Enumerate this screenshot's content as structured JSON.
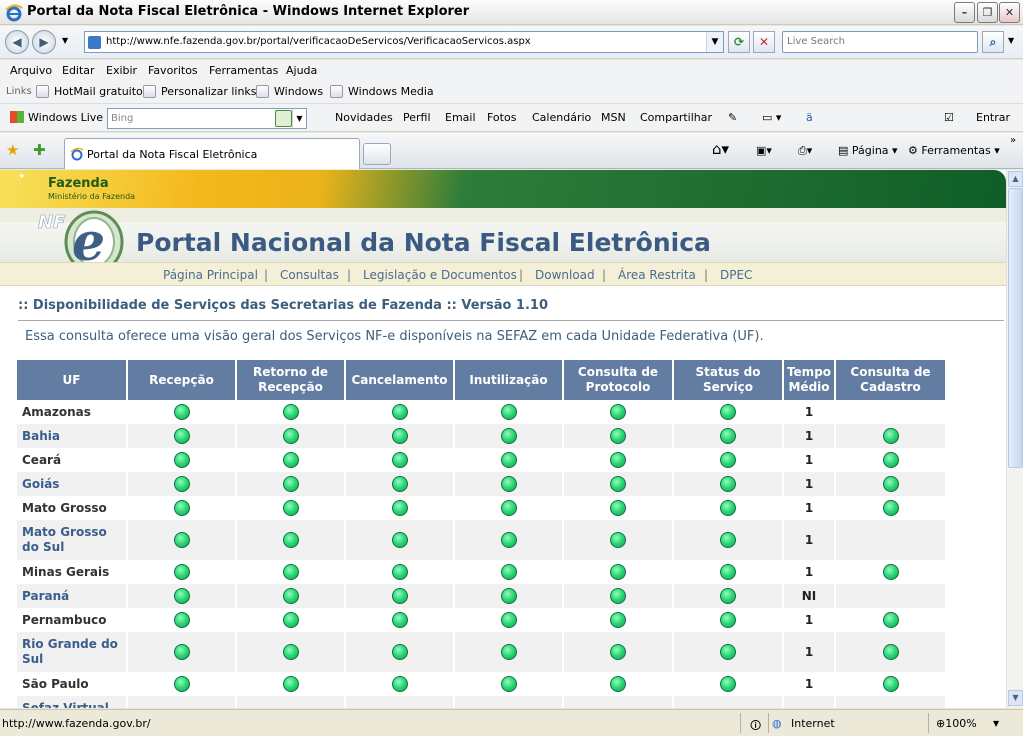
{
  "window": {
    "title": "Portal da Nota Fiscal Eletrônica - Windows Internet Explorer",
    "address": "http://www.nfe.fazenda.gov.br/portal/verificacaoDeServicos/VerificacaoServicos.aspx",
    "search_placeholder": "Live Search"
  },
  "menu": [
    "Arquivo",
    "Editar",
    "Exibir",
    "Favoritos",
    "Ferramentas",
    "Ajuda"
  ],
  "links_bar": {
    "label": "Links",
    "items": [
      "HotMail gratuito",
      "Personalizar links",
      "Windows",
      "Windows Media"
    ]
  },
  "live_bar": {
    "brand": "Windows Live",
    "search_placeholder": "Bing",
    "items": [
      "Novidades",
      "Perfil",
      "Email",
      "Fotos",
      "Calendário",
      "MSN",
      "Compartilhar"
    ],
    "signin": "Entrar"
  },
  "tabs": {
    "active": "Portal da Nota Fiscal Eletrônica",
    "page_menu": "Página",
    "tools_menu": "Ferramentas"
  },
  "page": {
    "banner_title": "Fazenda",
    "banner_subtitle": "Ministério da Fazenda",
    "portal_title": "Portal Nacional da Nota Fiscal Eletrônica",
    "nav": [
      "Página Principal",
      "Consultas",
      "Legislação e Documentos",
      "Download",
      "Área Restrita",
      "DPEC"
    ],
    "section_title": ":: Disponibilidade de Serviços das Secretarias de Fazenda :: Versão 1.10",
    "intro": "Essa consulta oferece uma visão geral dos Serviços NF-e disponíveis na SEFAZ em cada Unidade Federativa (UF).",
    "columns": [
      "UF",
      "Recepção",
      "Retorno de Recepção",
      "Cancelamento",
      "Inutilização",
      "Consulta de Protocolo",
      "Status do Serviço",
      "Tempo Médio",
      "Consulta de Cadastro"
    ],
    "status_color": "#2edb7a",
    "rows": [
      {
        "uf": "Amazonas",
        "link": false,
        "tempo": "1",
        "cadastro": false
      },
      {
        "uf": "Bahia",
        "link": true,
        "tempo": "1",
        "cadastro": true
      },
      {
        "uf": "Ceará",
        "link": false,
        "tempo": "1",
        "cadastro": true
      },
      {
        "uf": "Goiás",
        "link": true,
        "tempo": "1",
        "cadastro": true
      },
      {
        "uf": "Mato Grosso",
        "link": false,
        "tempo": "1",
        "cadastro": true
      },
      {
        "uf": "Mato Grosso do Sul",
        "link": true,
        "tempo": "1",
        "cadastro": false
      },
      {
        "uf": "Minas Gerais",
        "link": false,
        "tempo": "1",
        "cadastro": true
      },
      {
        "uf": "Paraná",
        "link": true,
        "tempo": "NI",
        "cadastro": false
      },
      {
        "uf": "Pernambuco",
        "link": false,
        "tempo": "1",
        "cadastro": true
      },
      {
        "uf": "Rio Grande do Sul",
        "link": true,
        "tempo": "1",
        "cadastro": true
      },
      {
        "uf": "São Paulo",
        "link": false,
        "tempo": "1",
        "cadastro": true
      },
      {
        "uf": "Sefaz Virtual",
        "link": true,
        "tempo": "",
        "cadastro": false
      }
    ]
  },
  "status": {
    "url": "http://www.fazenda.gov.br/",
    "zone": "Internet",
    "zoom": "100%"
  }
}
